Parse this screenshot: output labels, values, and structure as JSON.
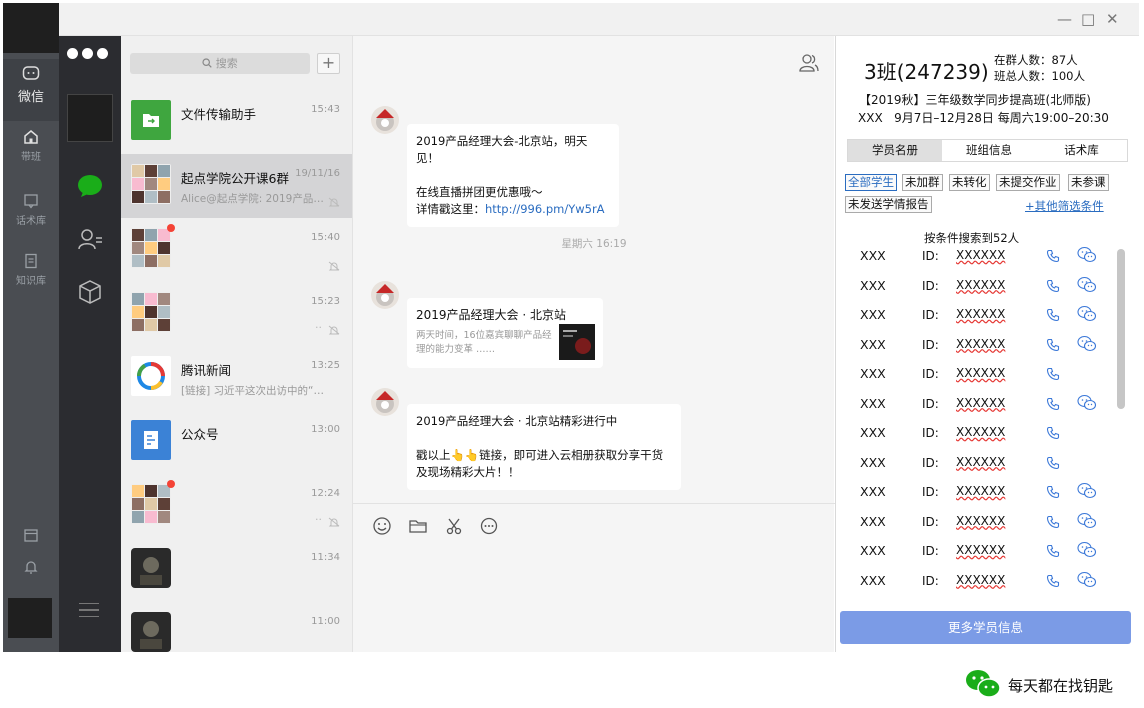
{
  "colors": {
    "wechat_green": "#1aad19",
    "link_blue": "#2a6cc0",
    "primary_button": "#7b9be6",
    "sidebar_dark": "#2b2c30",
    "rail_gray": "#4a4d52"
  },
  "outer_rail": {
    "items": [
      {
        "label": "微信",
        "icon": "chat-bubble-icon",
        "active": true
      },
      {
        "label": "带班",
        "icon": "home-icon",
        "active": false
      },
      {
        "label": "话术库",
        "icon": "message-box-icon",
        "active": false
      },
      {
        "label": "知识库",
        "icon": "document-icon",
        "active": false
      }
    ],
    "bottom_icons": [
      "calendar-icon",
      "bell-icon"
    ]
  },
  "wechat_sidebar": {
    "icons": [
      "chat-icon",
      "contacts-icon",
      "box-icon",
      "menu-icon"
    ]
  },
  "window_controls": {
    "minimize": "—",
    "maximize": "□",
    "close": "✕"
  },
  "chat_list": {
    "search_placeholder": "搜索",
    "add_label": "+",
    "items": [
      {
        "name": "文件传输助手",
        "time": "15:43",
        "preview": "",
        "avatar": "file-transfer",
        "active": false,
        "unread": false,
        "muted": false
      },
      {
        "name": "起点学院公开课6群",
        "time": "19/11/16",
        "preview": "Alice@起点学院: 2019产品…",
        "avatar": "group",
        "active": true,
        "unread": false,
        "muted": true
      },
      {
        "name": "",
        "time": "15:40",
        "preview": "",
        "avatar": "group",
        "active": false,
        "unread": true,
        "muted": true
      },
      {
        "name": "",
        "time": "15:23",
        "preview": "..",
        "avatar": "group",
        "active": false,
        "unread": false,
        "muted": true
      },
      {
        "name": "腾讯新闻",
        "time": "13:25",
        "preview": "[链接] 习近平这次出访中的“偶…",
        "avatar": "tencent-news",
        "active": false,
        "unread": false,
        "muted": false
      },
      {
        "name": "公众号",
        "time": "13:00",
        "preview": "",
        "avatar": "official-account",
        "active": false,
        "unread": false,
        "muted": false
      },
      {
        "name": "",
        "time": "12:24",
        "preview": "..",
        "avatar": "group",
        "active": false,
        "unread": true,
        "muted": true
      },
      {
        "name": "",
        "time": "11:34",
        "preview": "",
        "avatar": "photo",
        "active": false,
        "unread": false,
        "muted": false
      },
      {
        "name": "",
        "time": "11:00",
        "preview": "",
        "avatar": "photo",
        "active": false,
        "unread": false,
        "muted": false
      }
    ]
  },
  "chat": {
    "messages": [
      {
        "lines": [
          "2019产品经理大会-北京站，明天见！",
          "",
          "在线直播拼团更优惠哦～",
          "详情戳这里："
        ],
        "link": "http://996.pm/Yw5rA"
      },
      {
        "card_title": "2019产品经理大会 · 北京站",
        "card_desc": "两天时间，16位嘉宾聊聊产品经理的能力变革 ……"
      },
      {
        "lines": [
          "2019产品经理大会 · 北京站精彩进行中",
          "",
          "戳以上👆👆链接，即可进入云相册获取分享干货",
          "及现场精彩大片！！"
        ]
      }
    ],
    "date_separator": "星期六 16:19",
    "toolbar_icons": [
      "emoji-icon",
      "folder-icon",
      "scissors-icon",
      "chat-history-icon"
    ]
  },
  "class_panel": {
    "title": "3班(247239)",
    "group_count": "在群人数：87人",
    "total_count": "班总人数：100人",
    "course": "【2019秋】三年级数学同步提高班(北师版)",
    "teacher": "XXX",
    "schedule": "9月7日–12月28日 每周六19:00–20:30",
    "tabs": [
      "学员名册",
      "班组信息",
      "话术库"
    ],
    "filters": [
      "全部学生",
      "未加群",
      "未转化",
      "未提交作业",
      "未参课",
      "未发送学情报告"
    ],
    "more_filters": "+其他筛选条件",
    "result_count": "按条件搜索到52人",
    "id_label": "ID:",
    "students": [
      {
        "name": "XXX",
        "id": "XXXXXX",
        "wechat": true
      },
      {
        "name": "XXX",
        "id": "XXXXXX",
        "wechat": true
      },
      {
        "name": "XXX",
        "id": "XXXXXX",
        "wechat": true
      },
      {
        "name": "XXX",
        "id": "XXXXXX",
        "wechat": true
      },
      {
        "name": "XXX",
        "id": "XXXXXX",
        "wechat": false
      },
      {
        "name": "XXX",
        "id": "XXXXXX",
        "wechat": true
      },
      {
        "name": "XXX",
        "id": "XXXXXX",
        "wechat": false
      },
      {
        "name": "XXX",
        "id": "XXXXXX",
        "wechat": false
      },
      {
        "name": "XXX",
        "id": "XXXXXX",
        "wechat": true
      },
      {
        "name": "XXX",
        "id": "XXXXXX",
        "wechat": true
      },
      {
        "name": "XXX",
        "id": "XXXXXX",
        "wechat": true
      },
      {
        "name": "XXX",
        "id": "XXXXXX",
        "wechat": true
      }
    ],
    "more_button": "更多学员信息"
  },
  "watermark": {
    "text": "每天都在找钥匙"
  }
}
